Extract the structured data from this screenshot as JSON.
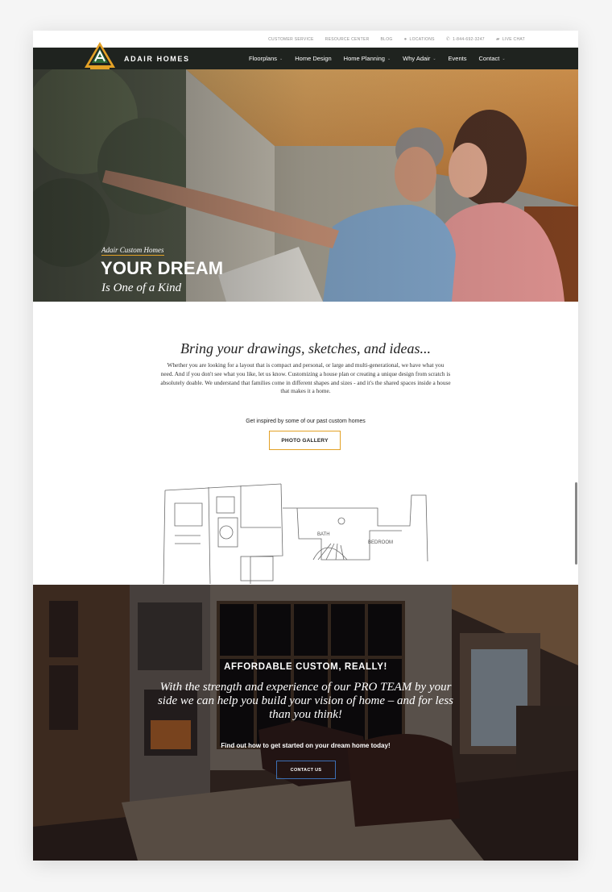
{
  "utility_nav": {
    "customer_service": "CUSTOMER SERVICE",
    "resource_center": "RESOURCE CENTER",
    "blog": "BLOG",
    "locations": "LOCATIONS",
    "phone": "1-844-692-3247",
    "live_chat": "LIVE CHAT",
    "icons": [
      "location-pin-icon",
      "phone-icon",
      "chat-icon"
    ]
  },
  "brand": {
    "name": "ADAIR HOMES",
    "colors": {
      "accent": "#e3a126",
      "nav_bg": "#1f231f",
      "logo_green": "#2e6b3a",
      "button_blue": "#3d6fb5"
    }
  },
  "main_nav": {
    "items": [
      {
        "label": "Floorplans",
        "dropdown": true
      },
      {
        "label": "Home Design",
        "dropdown": false
      },
      {
        "label": "Home Planning",
        "dropdown": true
      },
      {
        "label": "Why Adair",
        "dropdown": true
      },
      {
        "label": "Events",
        "dropdown": false
      },
      {
        "label": "Contact",
        "dropdown": true
      }
    ]
  },
  "hero": {
    "kicker": "Adair Custom Homes",
    "title": "YOUR DREAM",
    "subtitle": "Is One of a Kind"
  },
  "intro": {
    "heading": "Bring your drawings, sketches, and ideas...",
    "body": "Whether you are looking for a layout that is compact and personal, or large and multi-generational, we have what you need. And if you don't see what you like, let us know. Customizing a house plan or creating a unique design from scratch is absolutely doable. We understand that families come in different shapes and sizes - and it's the shared spaces inside a house that makes it a home.",
    "inspire_text": "Get inspired by some of our past custom homes",
    "gallery_button": "PHOTO GALLERY"
  },
  "sketch": {
    "labels": [
      "BATH",
      "BEDROOM"
    ]
  },
  "cta_section": {
    "kicker": "AFFORDABLE CUSTOM, REALLY!",
    "quote": "With the strength and experience of our PRO TEAM by your side we can help you build your vision of home – and for less than you think!",
    "cta_text": "Find out how to get started on your dream home today!",
    "contact_button": "CONTACT US"
  }
}
